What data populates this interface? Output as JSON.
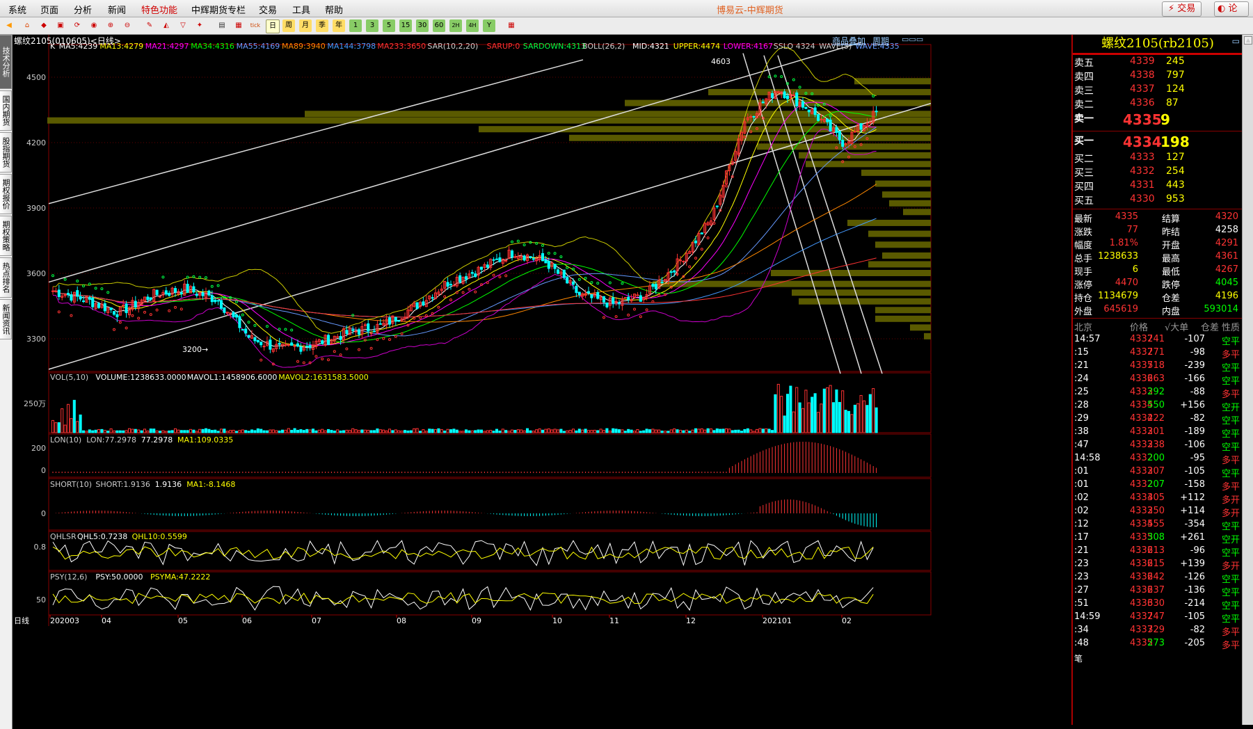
{
  "menu": {
    "items": [
      "系统",
      "页面",
      "分析",
      "新闻",
      "特色功能",
      "中辉期货专栏",
      "交易",
      "工具",
      "帮助"
    ],
    "app_title": "博易云-中辉期货",
    "trade_button": "交易",
    "forum_button": "论坛"
  },
  "toolbar": {
    "period_buttons": [
      "日",
      "周",
      "月",
      "季",
      "年"
    ],
    "minute_buttons": [
      "1",
      "3",
      "5",
      "15",
      "30",
      "60",
      "2H",
      "4H",
      "Y"
    ]
  },
  "left_rail": {
    "tabs": [
      "技术分析",
      "国内期货",
      "股指期货",
      "期权报价",
      "期权策略",
      "热点排名",
      "新闻资讯"
    ]
  },
  "chart": {
    "title": "螺纹2105(010605)<日线>",
    "link_overlay": "商品叠加",
    "link_period": "周期",
    "main_indicator_text": [
      {
        "t": "K",
        "c": "#ffffff"
      },
      {
        "t": "MA5:4239",
        "c": "#ffffff"
      },
      {
        "t": "MA13:4279",
        "c": "#ffff00"
      },
      {
        "t": "MA21:4297",
        "c": "#ff00ff"
      },
      {
        "t": "MA34:4316",
        "c": "#00ff00"
      },
      {
        "t": "MA55:4169",
        "c": "#6699ff"
      },
      {
        "t": "MA89:3940",
        "c": "#ff8800"
      },
      {
        "t": "MA144:3798",
        "c": "#4499ff"
      },
      {
        "t": "MA233:3650",
        "c": "#ff3333"
      },
      {
        "t": "SAR(10,2,20)",
        "c": "#cccccc"
      },
      {
        "t": "SARUP:0",
        "c": "#ff3333"
      },
      {
        "t": "SARDOWN:4313",
        "c": "#00ff44"
      },
      {
        "t": "BOLL(26,2)",
        "c": "#cccccc"
      },
      {
        "t": "MID:4321",
        "c": "#ffffff"
      },
      {
        "t": "UPPER:4474",
        "c": "#ffff00"
      },
      {
        "t": "LOWER:4167",
        "c": "#ff00ff"
      },
      {
        "t": "SSLO 4324",
        "c": "#cccccc"
      },
      {
        "t": "WAVE(5)",
        "c": "#cccccc"
      },
      {
        "t": "WAVE:4335",
        "c": "#6699ff"
      }
    ],
    "price_axis": [
      "4500",
      "4200",
      "3900",
      "3600",
      "3300"
    ],
    "annot_high": "4603",
    "annot_low": "3200",
    "vol_text": [
      {
        "t": "VOL(5,10)",
        "c": "#cccccc"
      },
      {
        "t": "VOLUME:1238633.0000",
        "c": "#ffffff"
      },
      {
        "t": "MAVOL1:1458906.6000",
        "c": "#ffffff"
      },
      {
        "t": "MAVOL2:1631583.5000",
        "c": "#ffff00"
      }
    ],
    "vol_axis": "250万",
    "lon_text": [
      {
        "t": "LON(10)",
        "c": "#cccccc"
      },
      {
        "t": "LON:77.2978",
        "c": "#cccccc"
      },
      {
        "t": "77.2978",
        "c": "#ffffff"
      },
      {
        "t": "MA1:109.0335",
        "c": "#ffff00"
      }
    ],
    "lon_axis": [
      "200",
      "0"
    ],
    "short_text": [
      {
        "t": "SHORT(10)",
        "c": "#cccccc"
      },
      {
        "t": "SHORT:1.9136",
        "c": "#cccccc"
      },
      {
        "t": "1.9136",
        "c": "#ffffff"
      },
      {
        "t": "MA1:-8.1468",
        "c": "#ffff00"
      }
    ],
    "short_axis": "0",
    "qhlsr_text": [
      {
        "t": "QHLSR",
        "c": "#cccccc"
      },
      {
        "t": "QHL5:0.7238",
        "c": "#ffffff"
      },
      {
        "t": "QHL10:0.5599",
        "c": "#ffff00"
      }
    ],
    "qhlsr_axis": "0.8",
    "psy_text": [
      {
        "t": "PSY(12,6)",
        "c": "#cccccc"
      },
      {
        "t": "PSY:50.0000",
        "c": "#ffffff"
      },
      {
        "t": "PSYMA:47.2222",
        "c": "#ffff00"
      }
    ],
    "psy_axis": "50",
    "x_label_prefix": "日线",
    "x_labels": [
      "202003",
      "04",
      "05",
      "06",
      "07",
      "08",
      "09",
      "10",
      "11",
      "12",
      "202101",
      "02"
    ]
  },
  "chart_data": {
    "type": "candlestick",
    "title": "螺纹2105(010605)<日线>",
    "ylim": [
      3150,
      4650
    ],
    "annotations": {
      "high": 4603,
      "low": 3200
    },
    "x_ticks": [
      "202003",
      "04",
      "05",
      "06",
      "07",
      "08",
      "09",
      "10",
      "11",
      "12",
      "202101",
      "02"
    ],
    "last_values": {
      "MA5": 4239,
      "MA13": 4279,
      "MA21": 4297,
      "MA34": 4316,
      "MA55": 4169,
      "MA89": 3940,
      "MA144": 3798,
      "MA233": 3650,
      "SARDOWN": 4313,
      "MID": 4321,
      "UPPER": 4474,
      "LOWER": 4167,
      "WAVE": 4335,
      "VOLUME": 1238633,
      "MAVOL1": 1458906.6,
      "MAVOL2": 1631583.5,
      "LON": 77.2978,
      "LON_MA1": 109.0335,
      "SHORT": 1.9136,
      "SHORT_MA1": -8.1468,
      "QHL5": 0.7238,
      "QHL10": 0.5599,
      "PSY": 50.0,
      "PSYMA": 47.2222
    },
    "close_path_approx": [
      [
        "202003",
        3520
      ],
      [
        "202003",
        3480
      ],
      [
        "04",
        3420
      ],
      [
        "04",
        3500
      ],
      [
        "04",
        3530
      ],
      [
        "05",
        3480
      ],
      [
        "05",
        3300
      ],
      [
        "05",
        3250
      ],
      [
        "06",
        3280
      ],
      [
        "06",
        3330
      ],
      [
        "07",
        3360
      ],
      [
        "07",
        3450
      ],
      [
        "08",
        3560
      ],
      [
        "08",
        3620
      ],
      [
        "09",
        3700
      ],
      [
        "09",
        3650
      ],
      [
        "10",
        3500
      ],
      [
        "10",
        3460
      ],
      [
        "11",
        3500
      ],
      [
        "11",
        3650
      ],
      [
        "12",
        3850
      ],
      [
        "12",
        4300
      ],
      [
        "202101",
        4450
      ],
      [
        "202101",
        4350
      ],
      [
        "02",
        4200
      ],
      [
        "02",
        4335
      ]
    ]
  },
  "quote": {
    "contract_title": "螺纹2105(rb2105)",
    "asks": [
      {
        "label": "卖五",
        "price": "4339",
        "vol": "245"
      },
      {
        "label": "卖四",
        "price": "4338",
        "vol": "797"
      },
      {
        "label": "卖三",
        "price": "4337",
        "vol": "124"
      },
      {
        "label": "卖二",
        "price": "4336",
        "vol": "87"
      },
      {
        "label": "卖一",
        "price": "4335",
        "vol": "9"
      }
    ],
    "bids": [
      {
        "label": "买一",
        "price": "4334",
        "vol": "198"
      },
      {
        "label": "买二",
        "price": "4333",
        "vol": "127"
      },
      {
        "label": "买三",
        "price": "4332",
        "vol": "254"
      },
      {
        "label": "买四",
        "price": "4331",
        "vol": "443"
      },
      {
        "label": "买五",
        "price": "4330",
        "vol": "953"
      }
    ],
    "stats": [
      {
        "l1": "最新",
        "v1": "4335",
        "c1": "#ff3333",
        "l2": "结算",
        "v2": "4320",
        "c2": "#ff3333"
      },
      {
        "l1": "涨跌",
        "v1": "77",
        "c1": "#ff3333",
        "l2": "昨结",
        "v2": "4258",
        "c2": "#ffffff"
      },
      {
        "l1": "幅度",
        "v1": "1.81%",
        "c1": "#ff3333",
        "l2": "开盘",
        "v2": "4291",
        "c2": "#ff3333"
      },
      {
        "l1": "总手",
        "v1": "1238633",
        "c1": "#ffff00",
        "l2": "最高",
        "v2": "4361",
        "c2": "#ff3333"
      },
      {
        "l1": "现手",
        "v1": "6",
        "c1": "#ffff00",
        "l2": "最低",
        "v2": "4267",
        "c2": "#ff3333"
      },
      {
        "l1": "涨停",
        "v1": "4470",
        "c1": "#ff3333",
        "l2": "跌停",
        "v2": "4045",
        "c2": "#00ff00"
      },
      {
        "l1": "持仓",
        "v1": "1134679",
        "c1": "#ffff00",
        "l2": "仓差",
        "v2": "4196",
        "c2": "#ffff00"
      },
      {
        "l1": "外盘",
        "v1": "645619",
        "c1": "#ff3333",
        "l2": "内盘",
        "v2": "593014",
        "c2": "#00ff00"
      }
    ],
    "tick_header": [
      "北京",
      "价格",
      "√大单",
      "仓差",
      "性质"
    ],
    "ticks": [
      {
        "time": "14:57",
        "price": "4337",
        "vol": "241",
        "diff": "-107",
        "nature": "空平",
        "nc": "#00ff00",
        "vc": "#ff3333"
      },
      {
        "time": ":15",
        "price": "4337",
        "vol": "271",
        "diff": "-98",
        "nature": "多平",
        "nc": "#ff3333",
        "vc": "#ff3333"
      },
      {
        "time": ":21",
        "price": "4337",
        "vol": "518",
        "diff": "-239",
        "nature": "空平",
        "nc": "#00ff00",
        "vc": "#ff3333"
      },
      {
        "time": ":24",
        "price": "4336",
        "vol": "263",
        "diff": "-166",
        "nature": "空平",
        "nc": "#00ff00",
        "vc": "#ff3333"
      },
      {
        "time": ":25",
        "price": "4333",
        "vol": "292",
        "diff": "-88",
        "nature": "多平",
        "nc": "#ff3333",
        "vc": "#00ff00"
      },
      {
        "time": ":28",
        "price": "4334",
        "vol": "550",
        "diff": "+156",
        "nature": "空开",
        "nc": "#00ff00",
        "vc": "#00ff00"
      },
      {
        "time": ":29",
        "price": "4334",
        "vol": "222",
        "diff": "-82",
        "nature": "空平",
        "nc": "#00ff00",
        "vc": "#ff3333"
      },
      {
        "time": ":38",
        "price": "4333",
        "vol": "201",
        "diff": "-189",
        "nature": "空平",
        "nc": "#00ff00",
        "vc": "#ff3333"
      },
      {
        "time": ":47",
        "price": "4333",
        "vol": "238",
        "diff": "-106",
        "nature": "空平",
        "nc": "#00ff00",
        "vc": "#ff3333"
      },
      {
        "time": "14:58",
        "price": "4332",
        "vol": "200",
        "diff": "-95",
        "nature": "多平",
        "nc": "#ff3333",
        "vc": "#00ff00"
      },
      {
        "time": ":01",
        "price": "4333",
        "vol": "207",
        "diff": "-105",
        "nature": "空平",
        "nc": "#00ff00",
        "vc": "#ff3333"
      },
      {
        "time": ":01",
        "price": "4332",
        "vol": "207",
        "diff": "-158",
        "nature": "多平",
        "nc": "#ff3333",
        "vc": "#00ff00"
      },
      {
        "time": ":02",
        "price": "4333",
        "vol": "405",
        "diff": "+112",
        "nature": "多开",
        "nc": "#ff3333",
        "vc": "#ff3333"
      },
      {
        "time": ":02",
        "price": "4333",
        "vol": "250",
        "diff": "+114",
        "nature": "多开",
        "nc": "#ff3333",
        "vc": "#ff3333"
      },
      {
        "time": ":12",
        "price": "4334",
        "vol": "555",
        "diff": "-354",
        "nature": "空平",
        "nc": "#00ff00",
        "vc": "#ff3333"
      },
      {
        "time": ":17",
        "price": "4335",
        "vol": "308",
        "diff": "+261",
        "nature": "空开",
        "nc": "#00ff00",
        "vc": "#00ff00"
      },
      {
        "time": ":21",
        "price": "4336",
        "vol": "213",
        "diff": "-96",
        "nature": "空平",
        "nc": "#00ff00",
        "vc": "#ff3333"
      },
      {
        "time": ":23",
        "price": "4336",
        "vol": "215",
        "diff": "+139",
        "nature": "多开",
        "nc": "#ff3333",
        "vc": "#ff3333"
      },
      {
        "time": ":23",
        "price": "4336",
        "vol": "242",
        "diff": "-126",
        "nature": "空平",
        "nc": "#00ff00",
        "vc": "#ff3333"
      },
      {
        "time": ":27",
        "price": "4336",
        "vol": "237",
        "diff": "-136",
        "nature": "空平",
        "nc": "#00ff00",
        "vc": "#ff3333"
      },
      {
        "time": ":51",
        "price": "4336",
        "vol": "330",
        "diff": "-214",
        "nature": "空平",
        "nc": "#00ff00",
        "vc": "#ff3333"
      },
      {
        "time": "14:59",
        "price": "4337",
        "vol": "247",
        "diff": "-105",
        "nature": "空平",
        "nc": "#00ff00",
        "vc": "#ff3333"
      },
      {
        "time": ":34",
        "price": "4337",
        "vol": "329",
        "diff": "-82",
        "nature": "多平",
        "nc": "#ff3333",
        "vc": "#ff3333"
      },
      {
        "time": ":48",
        "price": "4335",
        "vol": "273",
        "diff": "-205",
        "nature": "多平",
        "nc": "#ff3333",
        "vc": "#00ff00"
      }
    ],
    "footer_label": "笔"
  }
}
